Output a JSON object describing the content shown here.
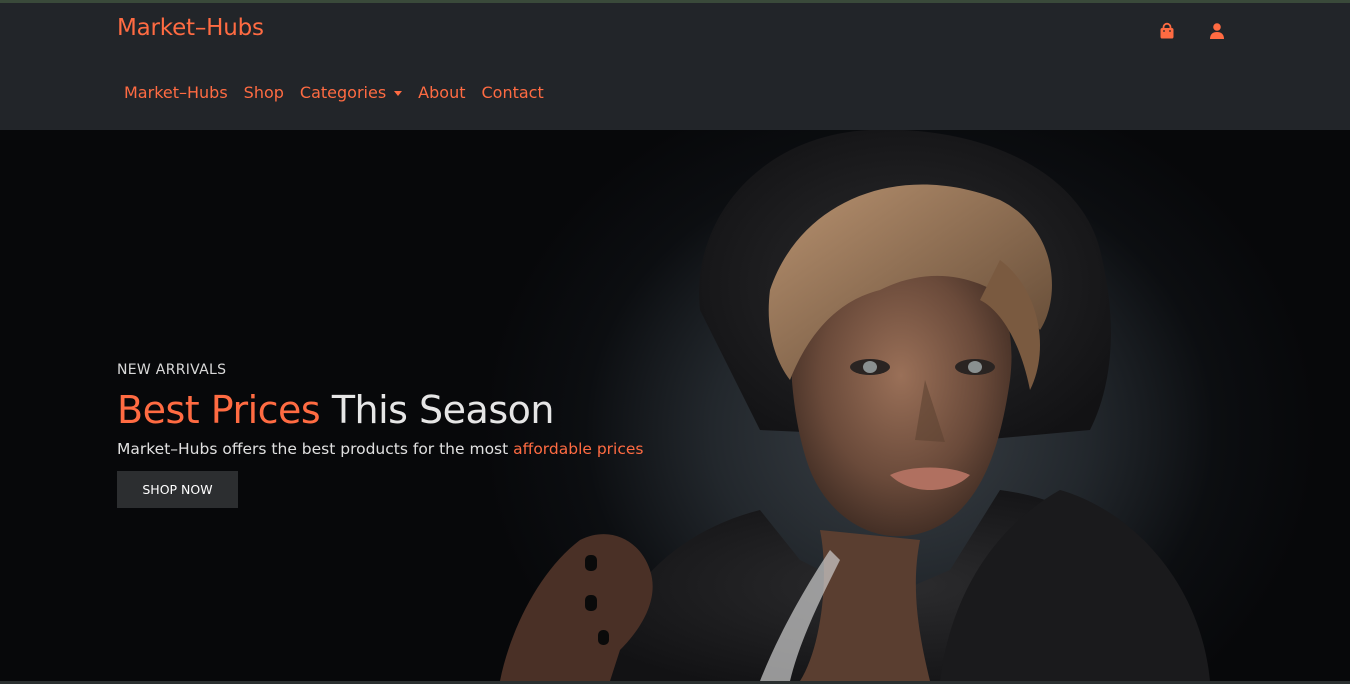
{
  "brand": {
    "name": "Market–Hubs"
  },
  "header_icons": {
    "cart": "shopping-bag-icon",
    "account": "user-icon"
  },
  "nav": {
    "items": [
      {
        "label": "Market–Hubs"
      },
      {
        "label": "Shop"
      },
      {
        "label": "Categories",
        "has_dropdown": true
      },
      {
        "label": "About"
      },
      {
        "label": "Contact"
      }
    ]
  },
  "hero": {
    "eyebrow": "NEW ARRIVALS",
    "headline_accent": "Best Prices",
    "headline_rest": " This Season",
    "subline_text": "Market–Hubs offers the best products for the most ",
    "subline_accent": "affordable prices",
    "cta_label": "SHOP NOW"
  },
  "colors": {
    "accent": "#ff6b42",
    "navbar_bg": "#222529",
    "hero_bg": "#0c0e11",
    "button_bg": "#2c2e30"
  }
}
